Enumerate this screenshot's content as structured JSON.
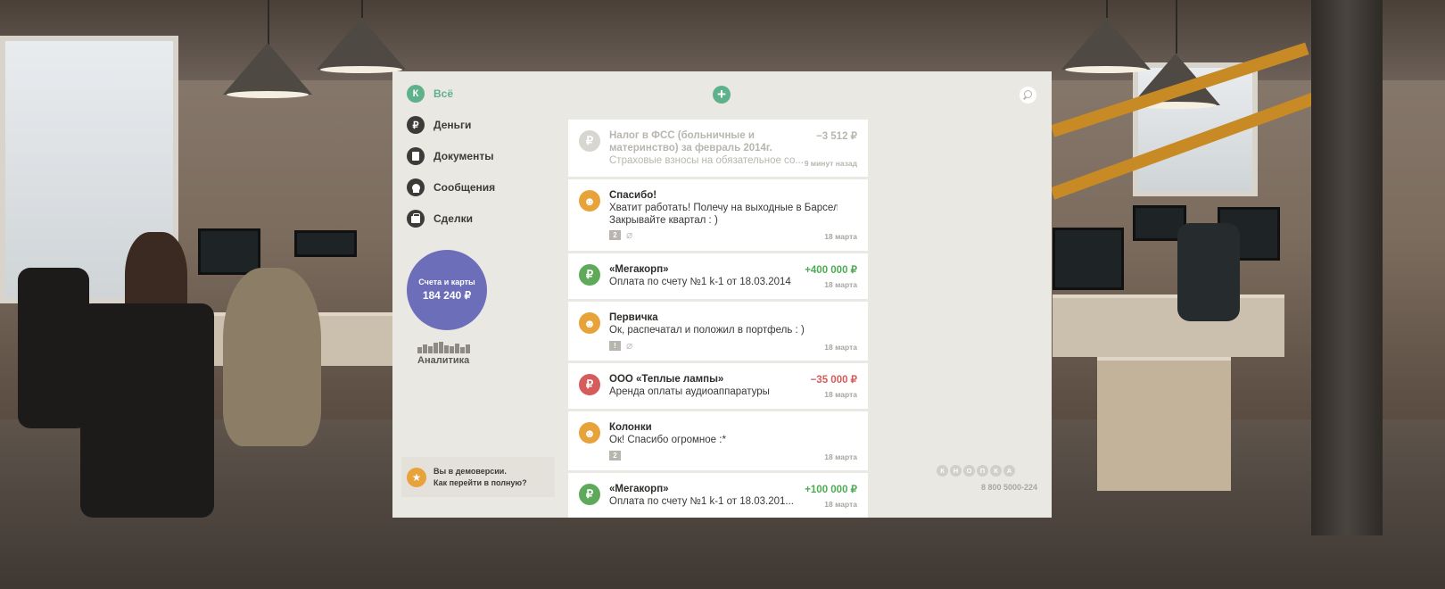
{
  "colors": {
    "accent_green": "#5eb18a",
    "dark_icon": "#3d3b38",
    "accounts_purple": "#6c6eb9",
    "orange": "#e8a23a",
    "red": "#d65b5b",
    "positive": "#4eab55",
    "negative": "#d65b5b"
  },
  "sidebar": {
    "items": [
      {
        "label": "Всё",
        "icon_char": "К",
        "icon": "kontur-logo-icon"
      },
      {
        "label": "Деньги",
        "icon_char": "₽",
        "icon": "ruble-icon"
      },
      {
        "label": "Документы",
        "icon_char": "",
        "icon": "document-icon"
      },
      {
        "label": "Сообщения",
        "icon_char": "",
        "icon": "message-icon"
      },
      {
        "label": "Сделки",
        "icon_char": "",
        "icon": "briefcase-icon"
      }
    ],
    "accounts": {
      "label": "Счета и карты",
      "amount": "184 240 ₽"
    },
    "analytics": {
      "label": "Аналитика"
    },
    "demo": {
      "line1": "Вы в демоверсии.",
      "line2": "Как перейти в полную?",
      "icon_char": "★"
    }
  },
  "toolbar": {
    "add_char": "+",
    "add_icon": "plus-icon",
    "search_icon": "search-icon"
  },
  "feed": [
    {
      "type": "money",
      "icon_char": "₽",
      "title": "Налог в ФСС (больничные и материнство) за февраль 2014г.",
      "lines": [
        "Страховые взносы на обязательное со..."
      ],
      "amount": "−3 512 ₽",
      "time": "9 минут назад"
    },
    {
      "type": "message",
      "icon_char": "☻",
      "title": "Спасибо!",
      "lines": [
        "Хватит работать! Полечу на выходные в Барселону.",
        "Закрывайте квартал : )"
      ],
      "time": "18 марта",
      "note_char": "2"
    },
    {
      "type": "money",
      "icon_char": "₽",
      "title": "«Мегакорп»",
      "lines": [
        "Оплата по счету №1 k-1 от 18.03.2014"
      ],
      "amount": "+400 000 ₽",
      "time": "18 марта"
    },
    {
      "type": "message",
      "icon_char": "☻",
      "title": "Первичка",
      "lines": [
        "Ок, распечатал и положил в портфель : )"
      ],
      "time": "18 марта",
      "note_char": "!"
    },
    {
      "type": "money",
      "icon_char": "₽",
      "title": "ООО «Теплые лампы»",
      "lines": [
        "Аренда оплаты аудиоаппаратуры"
      ],
      "amount": "−35 000 ₽",
      "time": "18 марта"
    },
    {
      "type": "message",
      "icon_char": "☻",
      "title": "Колонки",
      "lines": [
        "Ок! Спасибо огромное :*"
      ],
      "time": "18 марта",
      "note_char": "2"
    },
    {
      "type": "money",
      "icon_char": "₽",
      "title": "«Мегакорп»",
      "lines": [
        "Оплата по счету №1 k-1 от 18.03.201..."
      ],
      "amount": "+100 000 ₽",
      "time": "18 марта"
    }
  ],
  "brand": {
    "letters": [
      "К",
      "Н",
      "О",
      "П",
      "К",
      "А"
    ],
    "phone": "8 800 5000-224"
  }
}
